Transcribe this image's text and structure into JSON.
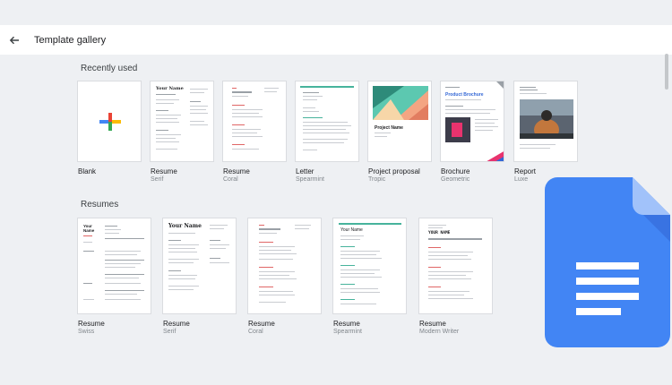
{
  "header": {
    "title": "Template gallery"
  },
  "recent": {
    "title": "Recently used",
    "items": [
      {
        "name": "Blank",
        "sub": ""
      },
      {
        "name": "Resume",
        "sub": "Serif",
        "heading": "Your Name"
      },
      {
        "name": "Resume",
        "sub": "Coral"
      },
      {
        "name": "Letter",
        "sub": "Spearmint"
      },
      {
        "name": "Project proposal",
        "sub": "Tropic",
        "heading": "Project Name"
      },
      {
        "name": "Brochure",
        "sub": "Geometric",
        "heading": "Product Brochure"
      },
      {
        "name": "Report",
        "sub": "Luxe"
      }
    ]
  },
  "resumes": {
    "title": "Resumes",
    "items": [
      {
        "name": "Resume",
        "sub": "Swiss",
        "heading": "Your Name"
      },
      {
        "name": "Resume",
        "sub": "Serif",
        "heading": "Your Name"
      },
      {
        "name": "Resume",
        "sub": "Coral"
      },
      {
        "name": "Resume",
        "sub": "Spearmint",
        "heading": "Your Name"
      },
      {
        "name": "Resume",
        "sub": "Modern Writer",
        "heading": "YOUR NAME"
      }
    ]
  },
  "colors": {
    "docs_blue": "#4285f4",
    "docs_dark": "#3367d6",
    "coral": "#e06666",
    "spearmint": "#47b39c"
  }
}
